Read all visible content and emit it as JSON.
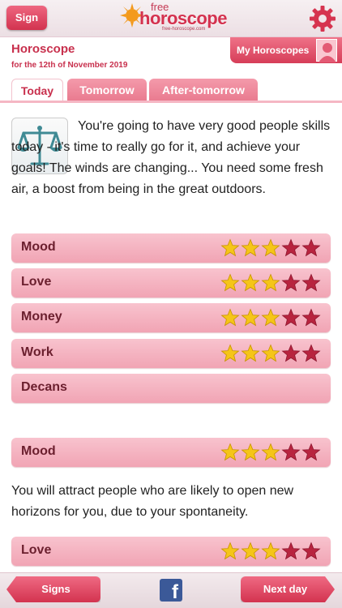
{
  "header": {
    "sign_label": "Sign",
    "logo_free": "free",
    "logo_main": "horoscope",
    "logo_sub": "free-horoscope.com",
    "settings_icon": "gear-icon"
  },
  "page": {
    "title": "Horoscope",
    "date": "for the 12th of November 2019",
    "my_horoscopes_label": "My Horoscopes"
  },
  "tabs": [
    {
      "label": "Today",
      "active": true
    },
    {
      "label": "Tomorrow",
      "active": false
    },
    {
      "label": "After-tomorrow",
      "active": false
    }
  ],
  "horoscope": {
    "sign_icon": "libra-scales-icon",
    "text": "You're going to have very good people skills today - it's time to really go for it, and achieve your goals! The winds are changing... You need some fresh air, a boost from being in the great outdoors."
  },
  "ratings": [
    {
      "label": "Mood",
      "stars": 3,
      "max": 5
    },
    {
      "label": "Love",
      "stars": 3,
      "max": 5
    },
    {
      "label": "Money",
      "stars": 3,
      "max": 5
    },
    {
      "label": "Work",
      "stars": 3,
      "max": 5
    },
    {
      "label": "Decans"
    }
  ],
  "details": [
    {
      "label": "Mood",
      "stars": 3,
      "max": 5,
      "text": "You will attract people who are likely to open new horizons for you, due to your spontaneity."
    },
    {
      "label": "Love",
      "stars": 3,
      "max": 5
    }
  ],
  "footer": {
    "signs_label": "Signs",
    "next_label": "Next day",
    "facebook_icon": "facebook-icon"
  },
  "colors": {
    "accent": "#d2334f",
    "row_bg": "#f4b2bf",
    "star_filled": "#f5c518",
    "star_empty": "#b8243f"
  }
}
